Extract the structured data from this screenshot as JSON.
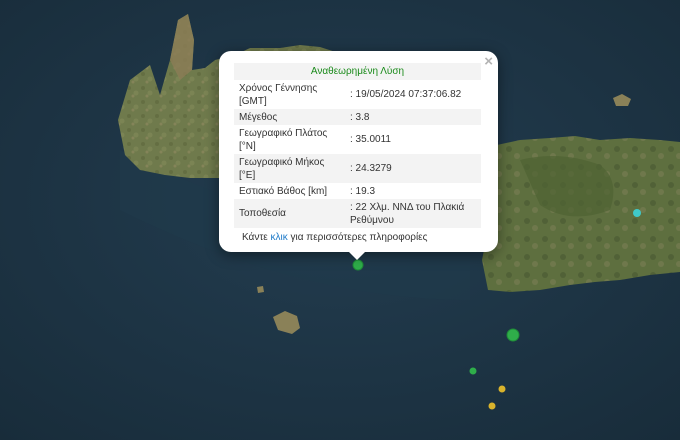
{
  "popup": {
    "title": "Αναθεωρημένη Λύση",
    "rows": [
      {
        "label": "Χρόνος Γέννησης [GMT]",
        "value": ": 19/05/2024 07:37:06.82"
      },
      {
        "label": "Μέγεθος",
        "value": ": 3.8"
      },
      {
        "label": "Γεωγραφικό Πλάτος [°N]",
        "value": ": 35.0011"
      },
      {
        "label": "Γεωγραφικό Μήκος [°E]",
        "value": ": 24.3279"
      },
      {
        "label": "Εστιακό Βάθος [km]",
        "value": ": 19.3"
      },
      {
        "label": "Τοποθεσία",
        "value": ": 22 Χλμ. ΝΝΔ του Πλακιά Ρεθύμνου"
      }
    ],
    "footer_before": "Κάντε ",
    "footer_link": "κλικ",
    "footer_after": " για περισσότερες πληροφορίες",
    "close": "×"
  },
  "colors": {
    "sea": "#1d3446",
    "land": "#6f7a4c",
    "marker_green": "#2fae4a",
    "marker_yellow": "#d9b32c",
    "marker_cyan": "#3fc9c9",
    "title_green": "#1a8a1a",
    "link_blue": "#1f7bc9"
  },
  "markers": [
    {
      "kind": "green",
      "label": "epicenter"
    },
    {
      "kind": "green"
    },
    {
      "kind": "green"
    },
    {
      "kind": "yellow"
    },
    {
      "kind": "yellow"
    },
    {
      "kind": "cyan"
    }
  ]
}
